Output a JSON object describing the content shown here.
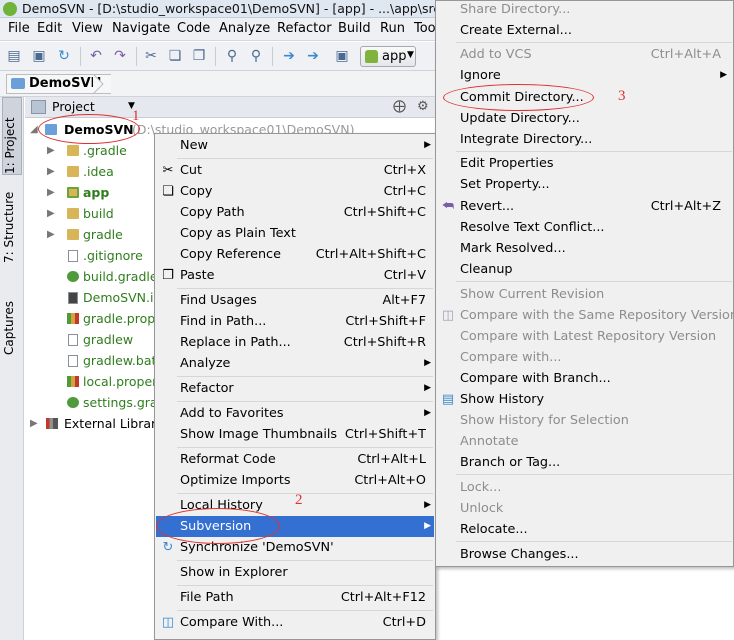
{
  "window": {
    "title": "DemoSVN - [D:\\studio_workspace01\\DemoSVN] - [app] - ...\\app\\src\\ma"
  },
  "menubar": {
    "items": [
      "File",
      "Edit",
      "View",
      "Navigate",
      "Code",
      "Analyze",
      "Refactor",
      "Build",
      "Run",
      "Too"
    ]
  },
  "toolbar": {
    "run_config": "app"
  },
  "breadcrumb": {
    "project": "DemoSVN"
  },
  "sidebar_tabs": {
    "project": "1: Project",
    "structure": "7: Structure",
    "captures": "Captures"
  },
  "project_panel": {
    "view_selector": "Project",
    "root": {
      "name": "DemoSVN",
      "path": "(D:\\studio_workspace01\\DemoSVN)"
    },
    "items": [
      ".gradle",
      ".idea",
      "app",
      "build",
      "gradle",
      ".gitignore",
      "build.gradle",
      "DemoSVN.iml",
      "gradle.properties",
      "gradlew",
      "gradlew.bat",
      "local.properties",
      "settings.gradle",
      "External Libraries"
    ]
  },
  "context_menu": {
    "items": [
      {
        "label": "New",
        "shortcut": ""
      },
      {
        "label": "Cut",
        "shortcut": "Ctrl+X"
      },
      {
        "label": "Copy",
        "shortcut": "Ctrl+C"
      },
      {
        "label": "Copy Path",
        "shortcut": "Ctrl+Shift+C"
      },
      {
        "label": "Copy as Plain Text",
        "shortcut": ""
      },
      {
        "label": "Copy Reference",
        "shortcut": "Ctrl+Alt+Shift+C"
      },
      {
        "label": "Paste",
        "shortcut": "Ctrl+V"
      },
      {
        "label": "Find Usages",
        "shortcut": "Alt+F7"
      },
      {
        "label": "Find in Path...",
        "shortcut": "Ctrl+Shift+F"
      },
      {
        "label": "Replace in Path...",
        "shortcut": "Ctrl+Shift+R"
      },
      {
        "label": "Analyze",
        "shortcut": ""
      },
      {
        "label": "Refactor",
        "shortcut": ""
      },
      {
        "label": "Add to Favorites",
        "shortcut": ""
      },
      {
        "label": "Show Image Thumbnails",
        "shortcut": "Ctrl+Shift+T"
      },
      {
        "label": "Reformat Code",
        "shortcut": "Ctrl+Alt+L"
      },
      {
        "label": "Optimize Imports",
        "shortcut": "Ctrl+Alt+O"
      },
      {
        "label": "Local History",
        "shortcut": ""
      },
      {
        "label": "Subversion",
        "shortcut": ""
      },
      {
        "label": "Synchronize 'DemoSVN'",
        "shortcut": ""
      },
      {
        "label": "Show in Explorer",
        "shortcut": ""
      },
      {
        "label": "File Path",
        "shortcut": "Ctrl+Alt+F12"
      },
      {
        "label": "Compare With...",
        "shortcut": "Ctrl+D"
      }
    ]
  },
  "subversion_menu": {
    "items": [
      {
        "label": "Share Directory...",
        "shortcut": ""
      },
      {
        "label": "Create External...",
        "shortcut": ""
      },
      {
        "label": "Add to VCS",
        "shortcut": "Ctrl+Alt+A"
      },
      {
        "label": "Ignore",
        "shortcut": ""
      },
      {
        "label": "Commit Directory...",
        "shortcut": ""
      },
      {
        "label": "Update Directory...",
        "shortcut": ""
      },
      {
        "label": "Integrate Directory...",
        "shortcut": ""
      },
      {
        "label": "Edit Properties",
        "shortcut": ""
      },
      {
        "label": "Set Property...",
        "shortcut": ""
      },
      {
        "label": "Revert...",
        "shortcut": "Ctrl+Alt+Z"
      },
      {
        "label": "Resolve Text Conflict...",
        "shortcut": ""
      },
      {
        "label": "Mark Resolved...",
        "shortcut": ""
      },
      {
        "label": "Cleanup",
        "shortcut": ""
      },
      {
        "label": "Show Current Revision",
        "shortcut": ""
      },
      {
        "label": "Compare with the Same Repository Version",
        "shortcut": ""
      },
      {
        "label": "Compare with Latest Repository Version",
        "shortcut": ""
      },
      {
        "label": "Compare with...",
        "shortcut": ""
      },
      {
        "label": "Compare with Branch...",
        "shortcut": ""
      },
      {
        "label": "Show History",
        "shortcut": ""
      },
      {
        "label": "Show History for Selection",
        "shortcut": ""
      },
      {
        "label": "Annotate",
        "shortcut": ""
      },
      {
        "label": "Branch or Tag...",
        "shortcut": ""
      },
      {
        "label": "Lock...",
        "shortcut": ""
      },
      {
        "label": "Unlock",
        "shortcut": ""
      },
      {
        "label": "Relocate...",
        "shortcut": ""
      },
      {
        "label": "Browse Changes...",
        "shortcut": ""
      }
    ]
  },
  "annotations": {
    "step1": "1",
    "step2": "2",
    "step3": "3",
    "color": "#e03131"
  },
  "colors": {
    "highlight": "#3470d2",
    "accent_green": "#2f7d1d"
  }
}
